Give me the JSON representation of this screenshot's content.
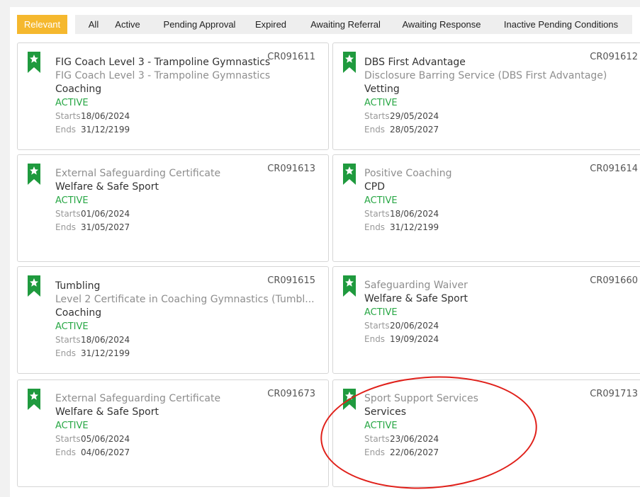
{
  "tabs": [
    {
      "label": "Relevant",
      "selected": true
    },
    {
      "label": "All"
    },
    {
      "label": "Active"
    },
    {
      "label": "Pending Approval"
    },
    {
      "label": "Expired"
    },
    {
      "label": "Awaiting Referral"
    },
    {
      "label": "Awaiting Response"
    },
    {
      "label": "Inactive Pending Conditions"
    }
  ],
  "labels": {
    "starts": "Starts",
    "ends": "Ends"
  },
  "cards": [
    {
      "code": "CR091611",
      "title": "FIG Coach Level 3 - Trampoline Gymnastics",
      "subtitle": "FIG Coach Level 3 - Trampoline Gymnastics",
      "category": "Coaching",
      "status": "ACTIVE",
      "starts": "18/06/2024",
      "ends": "31/12/2199"
    },
    {
      "code": "CR091612",
      "title": "DBS First Advantage",
      "subtitle": "Disclosure Barring Service (DBS First Advantage)",
      "category": "Vetting",
      "status": "ACTIVE",
      "starts": "29/05/2024",
      "ends": "28/05/2027"
    },
    {
      "code": "CR091613",
      "title": "",
      "subtitle": "External Safeguarding Certificate",
      "category": "Welfare & Safe Sport",
      "status": "ACTIVE",
      "starts": "01/06/2024",
      "ends": "31/05/2027"
    },
    {
      "code": "CR091614",
      "title": "",
      "subtitle": "Positive Coaching",
      "category": "CPD",
      "status": "ACTIVE",
      "starts": "18/06/2024",
      "ends": "31/12/2199"
    },
    {
      "code": "CR091615",
      "title": "Tumbling",
      "subtitle": "Level 2 Certificate in Coaching Gymnastics (Tumbl...",
      "category": "Coaching",
      "status": "ACTIVE",
      "starts": "18/06/2024",
      "ends": "31/12/2199"
    },
    {
      "code": "CR091660",
      "title": "",
      "subtitle": "Safeguarding Waiver",
      "category": "Welfare & Safe Sport",
      "status": "ACTIVE",
      "starts": "20/06/2024",
      "ends": "19/09/2024"
    },
    {
      "code": "CR091673",
      "title": "",
      "subtitle": "External Safeguarding Certificate",
      "category": "Welfare & Safe Sport",
      "status": "ACTIVE",
      "starts": "05/06/2024",
      "ends": "04/06/2027"
    },
    {
      "code": "CR091713",
      "title": "",
      "subtitle": "Sport Support Services",
      "category": "Services",
      "status": "ACTIVE",
      "starts": "23/06/2024",
      "ends": "22/06/2027"
    }
  ],
  "colors": {
    "tab_selected": "#f5b82e",
    "active_status": "#28a745",
    "ribbon": "#1f9a3e",
    "annotation": "#e0201a"
  }
}
